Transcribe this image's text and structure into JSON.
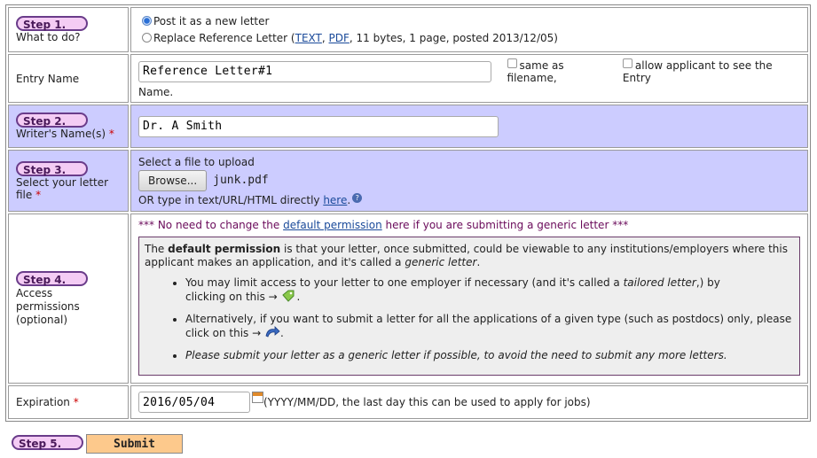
{
  "step1": {
    "badge": "Step 1.",
    "label": "What to do?",
    "option_new": "Post it as a new letter",
    "option_replace_prefix": "Replace Reference Letter (",
    "link_text": "TEXT",
    "separator": ", ",
    "link_pdf": "PDF",
    "replace_suffix": ", 11 bytes, 1 page, posted 2013/12/05)"
  },
  "entry_name": {
    "label": "Entry Name",
    "value": "Reference Letter#1",
    "same_as_filename": "same as filename,",
    "allow_applicant": "allow applicant to see the Entry",
    "allow_applicant_cont": "Name."
  },
  "step2": {
    "badge": "Step 2.",
    "label": "Writer's Name(s)",
    "required": "*",
    "value": "Dr. A Smith"
  },
  "step3": {
    "badge": "Step 3.",
    "label_line1": "Select your letter",
    "label_line2": "file",
    "required": "*",
    "select_prompt": "Select a file to upload",
    "browse": "Browse...",
    "filename": "junk.pdf",
    "or_type": "OR type in text/URL/HTML directly ",
    "here": "here",
    "period": "."
  },
  "step4": {
    "badge": "Step 4.",
    "label_line1": "Access",
    "label_line2": "permissions",
    "label_line3": "(optional)",
    "notice_prefix": "*** No need to change the ",
    "notice_link": "default permission",
    "notice_suffix": " here if you are submitting a generic letter ***",
    "intro_pre": "The ",
    "intro_bold": "default permission",
    "intro_mid": " is that your letter, once submitted, could be viewable to any institutions/employers where this applicant makes an application, and it's called a ",
    "intro_italic": "generic letter",
    "intro_end": ".",
    "bullet1_pre": "You may limit access to your letter to one employer if necessary (and it's called a ",
    "bullet1_italic": "tailored letter",
    "bullet1_post": ",) by",
    "bullet1_line2": "clicking on this →",
    "bullet2_line1": "Alternatively, if you want to submit a letter for all the applications of a given type (such as postdocs) only, please",
    "bullet2_line2": "click on this →",
    "bullet3": "Please submit your letter as a generic letter if possible, to avoid the need to submit any more letters."
  },
  "expiration": {
    "label": "Expiration",
    "required": "*",
    "value": "2016/05/04",
    "hint": "(YYYY/MM/DD, the last day this can be used to apply for jobs)"
  },
  "step5": {
    "badge": "Step 5.",
    "submit": "Submit"
  },
  "colors": {
    "step_row_bg": "#ccccff",
    "badge_bg": "#f4ccf4",
    "submit_bg": "#fdc98c",
    "notice_text": "#6a0a5a"
  },
  "icons": [
    "radio-selected",
    "radio-unselected",
    "checkbox",
    "help-icon",
    "tag-icon",
    "arrow-curve-icon",
    "calendar-icon"
  ]
}
